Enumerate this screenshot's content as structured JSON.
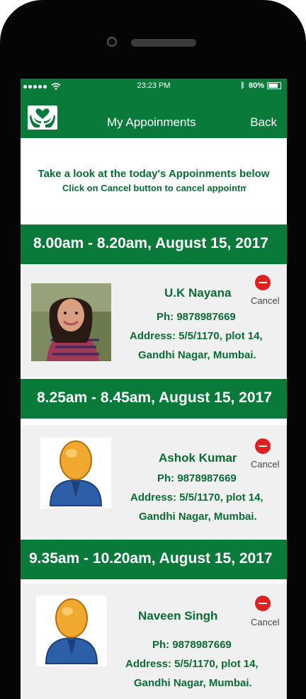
{
  "status_bar": {
    "time": "23:23 PM",
    "battery": "80%",
    "battery_level": 0.8
  },
  "nav": {
    "title": "My Appoinments",
    "back_label": "Back"
  },
  "intro": {
    "line1": "Take a look at the today's Appoinments below",
    "line2": "Click on Cancel button to cancel appointment"
  },
  "appointments": [
    {
      "time_slot": "8.00am - 8.20am, August 15, 2017",
      "name": "U.K Nayana",
      "phone": "Ph: 9878987669",
      "address_line1": "Address: 5/5/1170, plot 14,",
      "address_line2": "Gandhi Nagar, Mumbai.",
      "cancel_label": "Cancel",
      "photo": "woman-photo"
    },
    {
      "time_slot": "8.25am - 8.45am, August 15, 2017",
      "name": "Ashok Kumar",
      "phone": "Ph: 9878987669",
      "address_line1": "Address: 5/5/1170, plot 14,",
      "address_line2": "Gandhi Nagar, Mumbai.",
      "cancel_label": "Cancel",
      "photo": "user-avatar-icon"
    },
    {
      "time_slot": "9.35am - 10.20am, August 15, 2017",
      "name": "Naveen Singh",
      "phone": "Ph: 9878987669",
      "address_line1": "Address: 5/5/1170, plot 14,",
      "address_line2": "Gandhi Nagar, Mumbai.",
      "cancel_label": "Cancel",
      "photo": "user-avatar-icon"
    }
  ],
  "colors": {
    "brand_green": "#0a7a3b",
    "text_green": "#0a6b35",
    "cancel_red": "#e02020"
  }
}
